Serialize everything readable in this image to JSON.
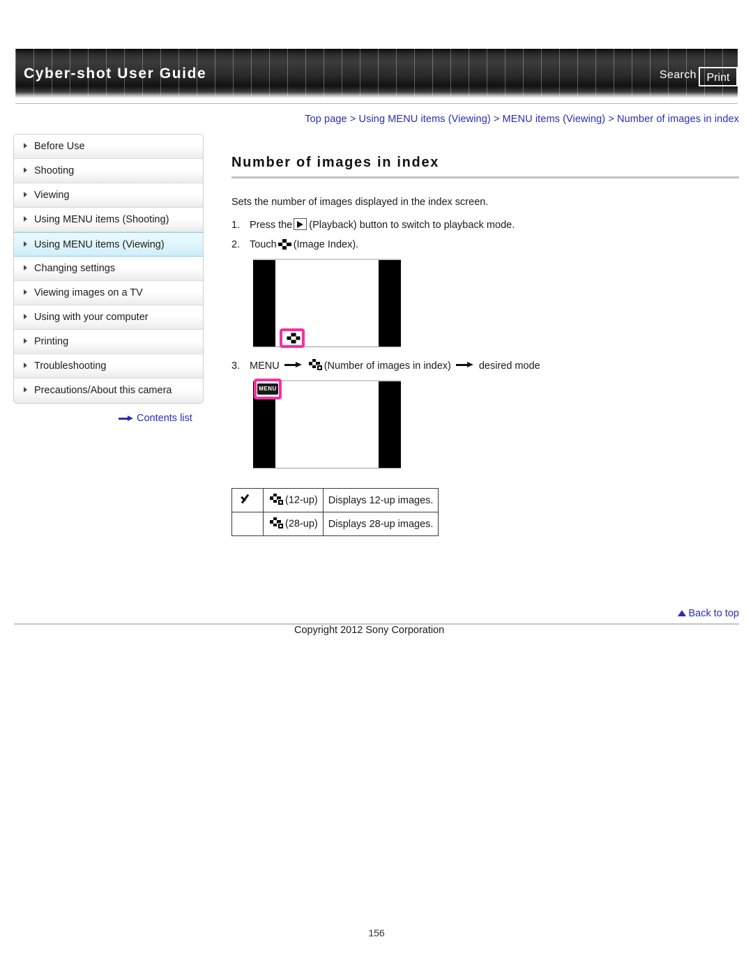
{
  "header": {
    "title": "Cyber-shot User Guide",
    "search_label": "Search",
    "print_label": "Print"
  },
  "breadcrumb": {
    "text": "Top page > Using MENU items (Viewing) > MENU items (Viewing) > Number of images in index"
  },
  "sidebar": {
    "items": [
      {
        "label": "Before Use",
        "active": false
      },
      {
        "label": "Shooting",
        "active": false
      },
      {
        "label": "Viewing",
        "active": false
      },
      {
        "label": "Using MENU items (Shooting)",
        "active": false
      },
      {
        "label": "Using MENU items (Viewing)",
        "active": true
      },
      {
        "label": "Changing settings",
        "active": false
      },
      {
        "label": "Viewing images on a TV",
        "active": false
      },
      {
        "label": "Using with your computer",
        "active": false
      },
      {
        "label": "Printing",
        "active": false
      },
      {
        "label": "Troubleshooting",
        "active": false
      },
      {
        "label": "Precautions/About this camera",
        "active": false
      }
    ],
    "contents_list_label": "Contents list"
  },
  "main": {
    "title": "Number of images in index",
    "intro": "Sets the number of images displayed in the index screen.",
    "steps": [
      {
        "number": "1.",
        "pre": "Press the",
        "icon": "playback-icon",
        "post": "(Playback) button to switch to playback mode."
      },
      {
        "number": "2.",
        "pre": "Touch",
        "icon": "image-index-icon",
        "post": "(Image Index)."
      },
      {
        "number": "3.",
        "pre": "MENU",
        "icon": "number-of-images-in-index-icon",
        "mid": "(Number of images in index)",
        "post": "desired mode"
      }
    ],
    "screenshot_1": {
      "highlight_icon": "image-index-icon"
    },
    "screenshot_2": {
      "highlight_icon": "menu-icon",
      "menu_chip_label": "MENU"
    },
    "options_table": {
      "rows": [
        {
          "selected": true,
          "icon": "index-12up-icon",
          "label": "(12-up)",
          "description": "Displays 12-up images."
        },
        {
          "selected": false,
          "icon": "index-28up-icon",
          "label": "(28-up)",
          "description": "Displays 28-up images."
        }
      ]
    }
  },
  "footer": {
    "back_to_top_label": "Back to top",
    "copyright": "Copyright 2012 Sony Corporation",
    "page_number": "156"
  },
  "colors": {
    "link": "#2b2bbb",
    "highlight": "#f5319d",
    "active_nav": "#cfeef8"
  }
}
